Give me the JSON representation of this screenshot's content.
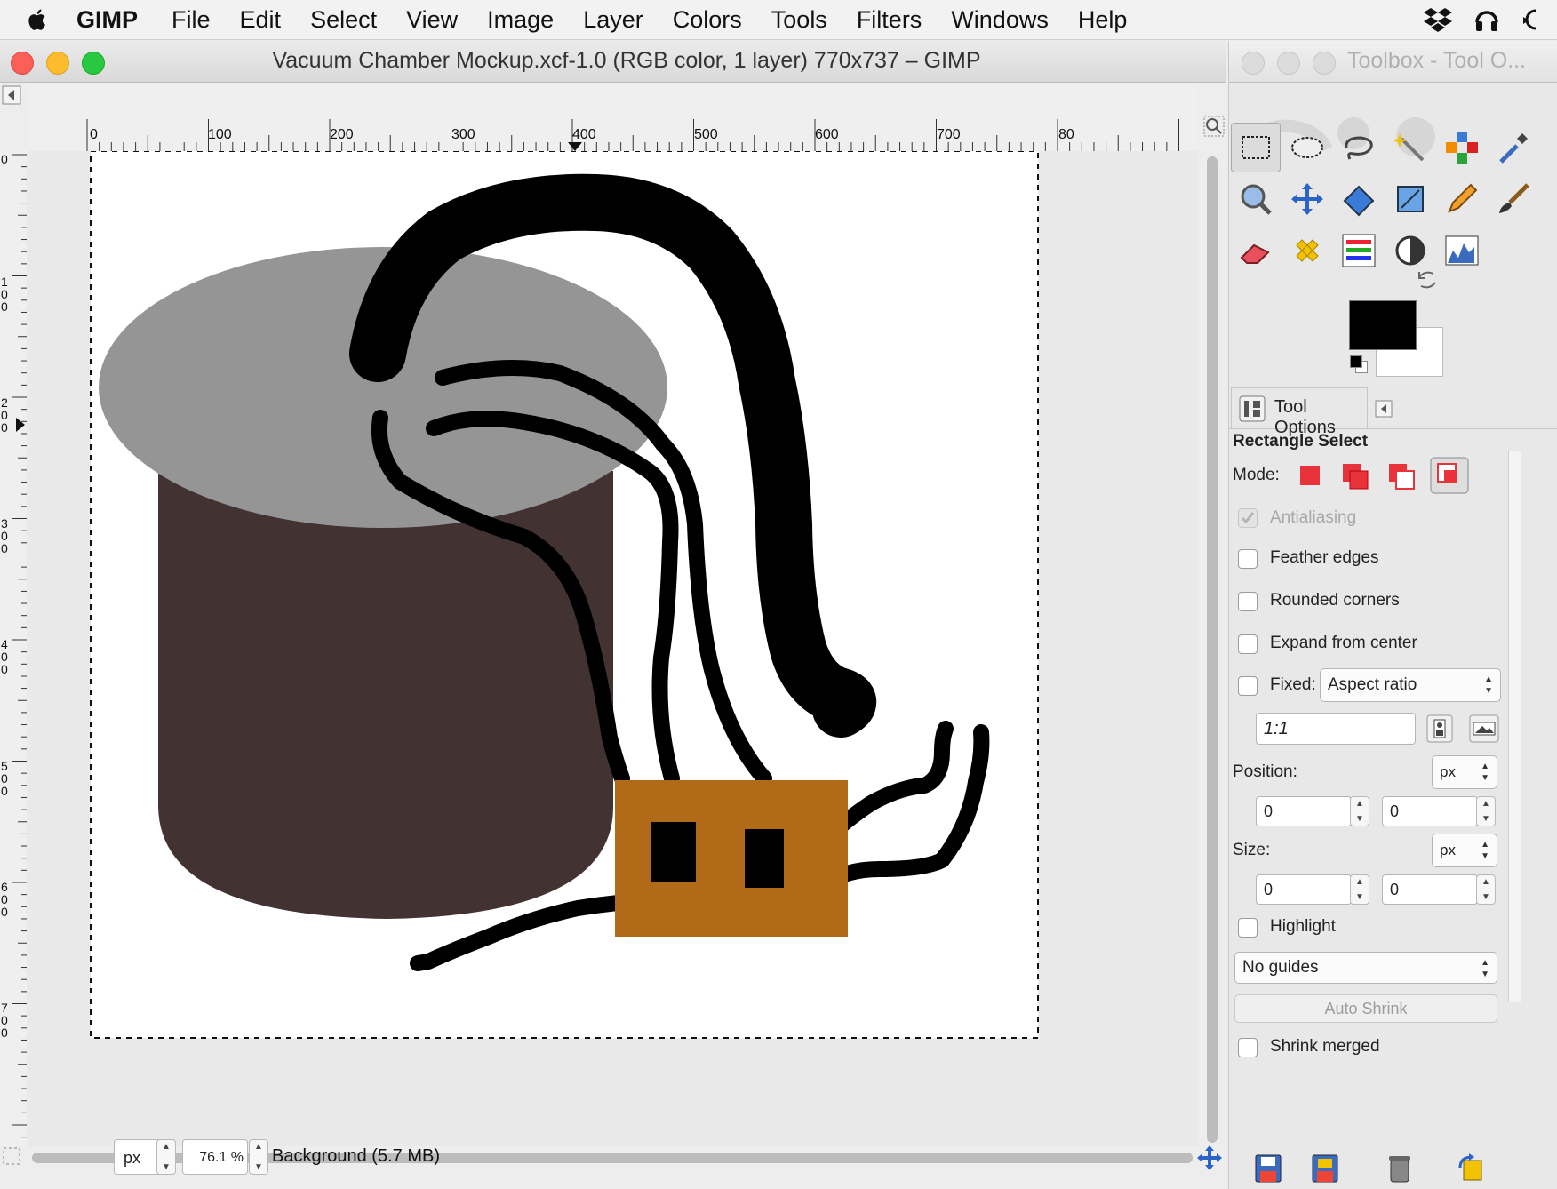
{
  "menubar": {
    "app_name": "GIMP",
    "items": [
      "File",
      "Edit",
      "Select",
      "View",
      "Image",
      "Layer",
      "Colors",
      "Tools",
      "Filters",
      "Windows",
      "Help"
    ]
  },
  "image_window": {
    "title": "Vacuum Chamber Mockup.xcf-1.0 (RGB color, 1 layer) 770x737 – GIMP",
    "ruler_h_labels": [
      "0",
      "100",
      "200",
      "300",
      "400",
      "500",
      "600",
      "700",
      "80"
    ],
    "ruler_v_labels": [
      "0",
      "1\n0\n0",
      "2\n0\n0",
      "3\n0\n0",
      "4\n0\n0",
      "5\n0\n0",
      "6\n0\n0",
      "7\n0\n0"
    ],
    "status": {
      "unit": "px",
      "zoom": "76.1 %",
      "layer_info": "Background (5.7 MB)"
    }
  },
  "toolbox": {
    "title": "Toolbox - Tool O...",
    "tools": [
      "rect-select-icon",
      "ellipse-select-icon",
      "lasso-icon",
      "fuzzy-select-icon",
      "select-by-color-icon",
      "color-picker-icon",
      "zoom-icon",
      "move-icon",
      "transform-icon",
      "crop-icon",
      "pencil-icon",
      "paintbrush-icon",
      "eraser-icon",
      "heal-icon",
      "color-balance-icon",
      "curves-icon",
      "levels-icon"
    ],
    "fg_color": "#000000",
    "bg_color": "#ffffff"
  },
  "tool_options": {
    "tab_label": "Tool Options",
    "title": "Rectangle Select",
    "mode_label": "Mode:",
    "antialiasing": "Antialiasing",
    "feather": "Feather edges",
    "rounded": "Rounded corners",
    "expand": "Expand from center",
    "fixed_label": "Fixed:",
    "fixed_value": "Aspect ratio",
    "ratio_value": "1:1",
    "position_label": "Position:",
    "position_unit": "px",
    "position_x": "0",
    "position_y": "0",
    "size_label": "Size:",
    "size_unit": "px",
    "size_w": "0",
    "size_h": "0",
    "highlight": "Highlight",
    "guides": "No guides",
    "auto_shrink": "Auto Shrink",
    "shrink_merged": "Shrink merged"
  },
  "colors": {
    "chamber_lid": "#959595",
    "chamber_body": "#433232",
    "box": "#b06a18",
    "stroke": "#000000"
  }
}
